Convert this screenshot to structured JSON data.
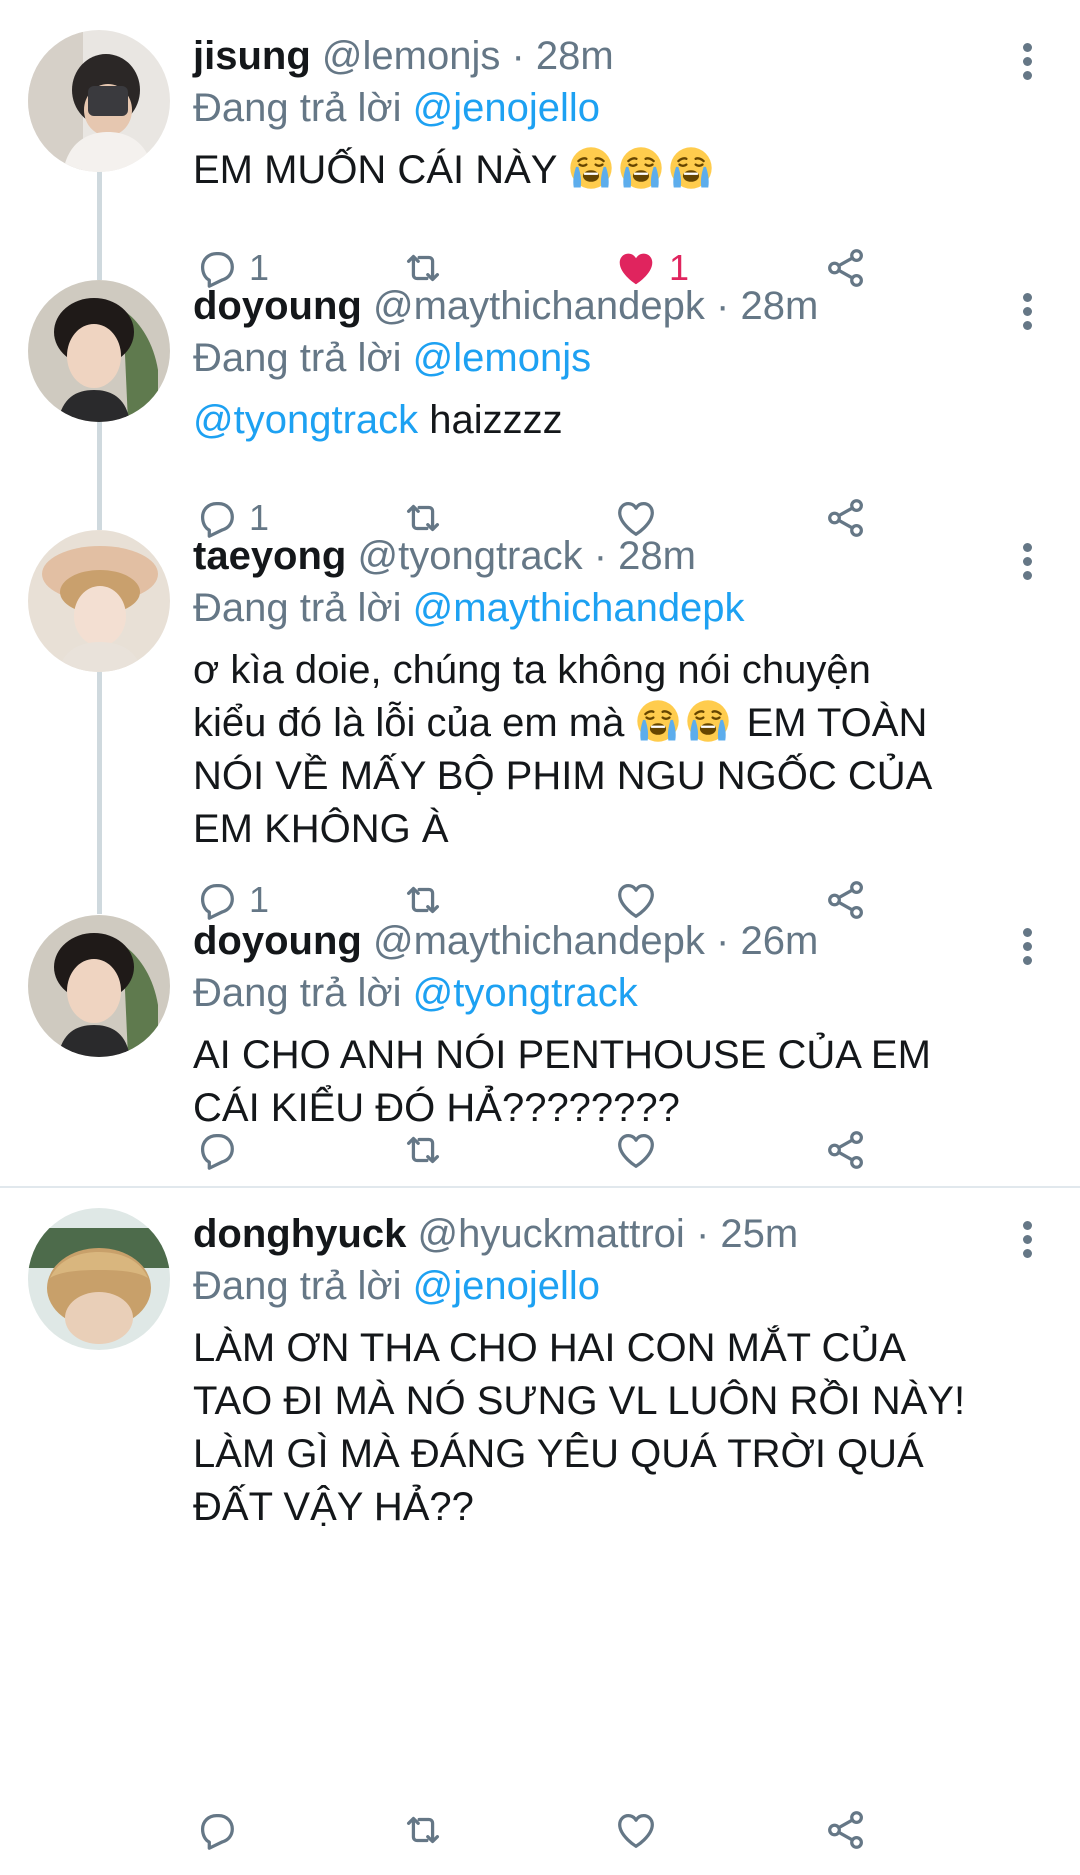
{
  "colors": {
    "accent": "#1da1f2",
    "muted": "#657786",
    "like": "#e0245e",
    "divider": "#e1e8ed"
  },
  "icons": {
    "reply": "reply-icon",
    "retweet": "retweet-icon",
    "like": "heart-icon",
    "share": "share-icon",
    "more": "more-vertical-icon",
    "emoji": "loudly-crying-face-emoji"
  },
  "tweets": [
    {
      "name": "jisung",
      "handle": "@lemonjs",
      "time": "· 28m",
      "replying_prefix": "Đang trả lời ",
      "replying_to": "@jenojello",
      "text": "EM MUỐN CÁI NÀY",
      "reply_count": "1",
      "like_count": "1",
      "liked": true
    },
    {
      "name": "doyoung",
      "handle": "@maythichandepk",
      "time": "· 28m",
      "replying_prefix": "Đang trả lời ",
      "replying_to": "@lemonjs",
      "text_mention": "@tyongtrack",
      "text": " haizzzz",
      "reply_count": "1",
      "like_count": "",
      "liked": false
    },
    {
      "name": "taeyong",
      "handle": "@tyongtrack",
      "time": "· 28m",
      "replying_prefix": "Đang trả lời ",
      "replying_to": "@maythichandepk",
      "text_part1": "ơ kìa doie, chúng ta không nói chuyện\nkiểu đó là lỗi của em mà ",
      "text_part2": " EM TOÀN\nNÓI VỀ MẤY BỘ PHIM NGU NGỐC CỦA\nEM KHÔNG À",
      "reply_count": "1",
      "like_count": "",
      "liked": false
    },
    {
      "name": "doyoung",
      "handle": "@maythichandepk",
      "time": "· 26m",
      "replying_prefix": "Đang trả lời ",
      "replying_to": "@tyongtrack",
      "text": "AI CHO ANH NÓI PENTHOUSE CỦA EM\nCÁI KIỂU ĐÓ HẢ????????",
      "reply_count": "",
      "like_count": "",
      "liked": false
    },
    {
      "name": "donghyuck",
      "handle": "@hyuckmattroi",
      "time": "· 25m",
      "replying_prefix": "Đang trả lời ",
      "replying_to": "@jenojello",
      "text": "LÀM ƠN THA CHO HAI CON MẮT CỦA\nTAO ĐI MÀ NÓ SƯNG VL LUÔN RỒI NÀY!\nLÀM GÌ MÀ ĐÁNG YÊU QUÁ TRỜI QUÁ\nĐẤT VẬY HẢ??",
      "reply_count": "",
      "like_count": "",
      "liked": false
    }
  ]
}
